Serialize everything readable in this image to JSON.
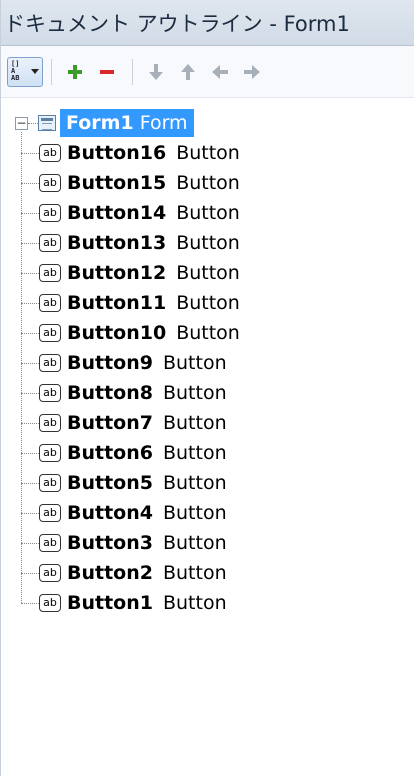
{
  "window": {
    "title": "ドキュメント アウトライン - Form1"
  },
  "toolbar": {
    "view_dropdown_icon": "view-options-icon",
    "buttons": [
      {
        "name": "add-button",
        "icon": "plus-icon",
        "color": "#3a9a2a"
      },
      {
        "name": "remove-button",
        "icon": "minus-icon",
        "color": "#d8262d"
      },
      {
        "name": "move-down-button",
        "icon": "arrow-down-icon"
      },
      {
        "name": "move-up-button",
        "icon": "arrow-up-icon"
      },
      {
        "name": "move-left-button",
        "icon": "arrow-left-icon"
      },
      {
        "name": "move-right-button",
        "icon": "arrow-right-icon"
      }
    ]
  },
  "tree": {
    "root": {
      "expander": "−",
      "name": "Form1",
      "type": "Form",
      "selected": true
    },
    "children": [
      {
        "icon": "ab",
        "name": "Button16",
        "type": "Button"
      },
      {
        "icon": "ab",
        "name": "Button15",
        "type": "Button"
      },
      {
        "icon": "ab",
        "name": "Button14",
        "type": "Button"
      },
      {
        "icon": "ab",
        "name": "Button13",
        "type": "Button"
      },
      {
        "icon": "ab",
        "name": "Button12",
        "type": "Button"
      },
      {
        "icon": "ab",
        "name": "Button11",
        "type": "Button"
      },
      {
        "icon": "ab",
        "name": "Button10",
        "type": "Button"
      },
      {
        "icon": "ab",
        "name": "Button9",
        "type": "Button"
      },
      {
        "icon": "ab",
        "name": "Button8",
        "type": "Button"
      },
      {
        "icon": "ab",
        "name": "Button7",
        "type": "Button"
      },
      {
        "icon": "ab",
        "name": "Button6",
        "type": "Button"
      },
      {
        "icon": "ab",
        "name": "Button5",
        "type": "Button"
      },
      {
        "icon": "ab",
        "name": "Button4",
        "type": "Button"
      },
      {
        "icon": "ab",
        "name": "Button3",
        "type": "Button"
      },
      {
        "icon": "ab",
        "name": "Button2",
        "type": "Button"
      },
      {
        "icon": "ab",
        "name": "Button1",
        "type": "Button"
      }
    ]
  },
  "colors": {
    "selection": "#3399ff",
    "titlebar": "#d8e0ea"
  }
}
